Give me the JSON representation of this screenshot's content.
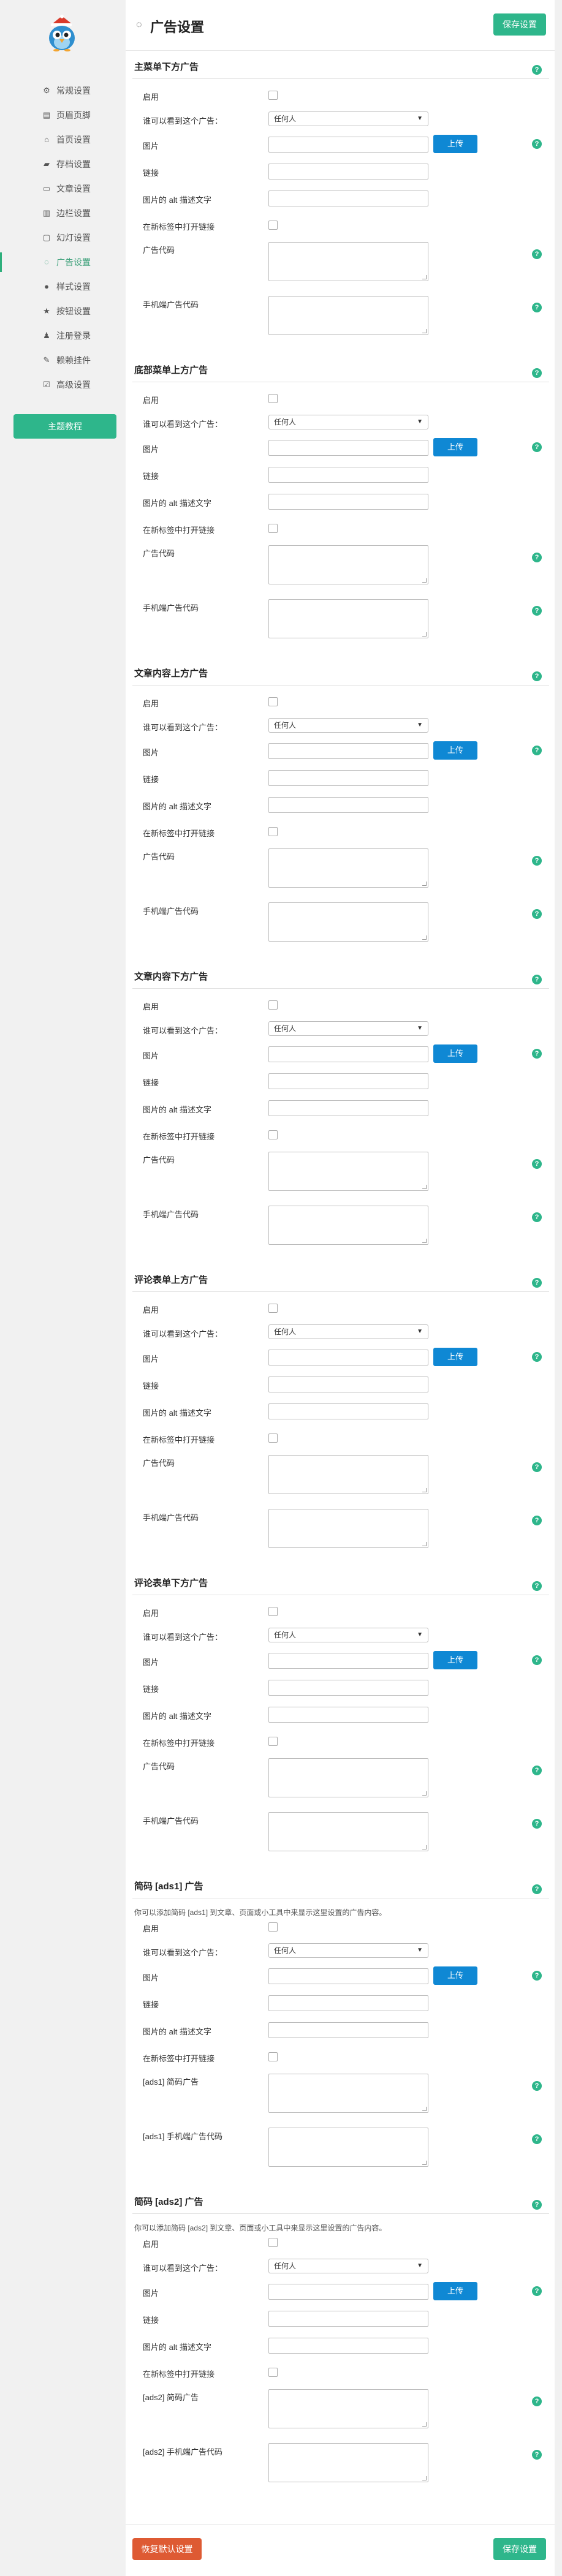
{
  "sidebar": {
    "logo_icon": "bird-mascot-logo",
    "items": [
      {
        "label": "常规设置",
        "icon": "gear-icon"
      },
      {
        "label": "页眉页脚",
        "icon": "layout-icon"
      },
      {
        "label": "首页设置",
        "icon": "home-icon"
      },
      {
        "label": "存档设置",
        "icon": "folder-icon"
      },
      {
        "label": "文章设置",
        "icon": "document-icon"
      },
      {
        "label": "边栏设置",
        "icon": "sidebar-icon"
      },
      {
        "label": "幻灯设置",
        "icon": "slides-icon"
      },
      {
        "label": "广告设置",
        "icon": "ad-icon",
        "active": true
      },
      {
        "label": "样式设置",
        "icon": "palette-icon"
      },
      {
        "label": "按钮设置",
        "icon": "star-icon"
      },
      {
        "label": "注册登录",
        "icon": "user-icon"
      },
      {
        "label": "赖赖挂件",
        "icon": "pen-icon"
      },
      {
        "label": "高级设置",
        "icon": "check-icon"
      }
    ],
    "theme_button": "主题教程"
  },
  "header": {
    "icon": "ad-icon",
    "title": "广告设置",
    "save_label": "保存设置"
  },
  "common": {
    "enable": "启用",
    "visible_to": "谁可以看到这个广告：",
    "visible_value": "任何人",
    "image": "图片",
    "upload": "上传",
    "link": "链接",
    "alt": "图片的 alt 描述文字",
    "new_tab": "在新标签中打开链接",
    "ad_code": "广告代码",
    "mobile_code": "手机端广告代码",
    "help": "?"
  },
  "sections": [
    {
      "title": "主菜单下方广告"
    },
    {
      "title": "底部菜单上方广告"
    },
    {
      "title": "文章内容上方广告"
    },
    {
      "title": "文章内容下方广告"
    },
    {
      "title": "评论表单上方广告"
    },
    {
      "title": "评论表单下方广告"
    },
    {
      "title": "简码 [ads1] 广告",
      "desc": "你可以添加简码 [ads1] 到文章、页面或小工具中来显示这里设置的广告内容。",
      "code_label": "[ads1] 简码广告",
      "mobile_label": "[ads1] 手机端广告代码"
    },
    {
      "title": "简码 [ads2] 广告",
      "desc": "你可以添加简码 [ads2] 到文章、页面或小工具中来显示这里设置的广告内容。",
      "code_label": "[ads2] 简码广告",
      "mobile_label": "[ads2] 手机端广告代码"
    }
  ],
  "footer": {
    "reset_label": "恢复默认设置",
    "save_label": "保存设置"
  },
  "colors": {
    "accent": "#2eb68b",
    "upload_blue": "#0f88d4",
    "reset_red": "#de5a33"
  }
}
